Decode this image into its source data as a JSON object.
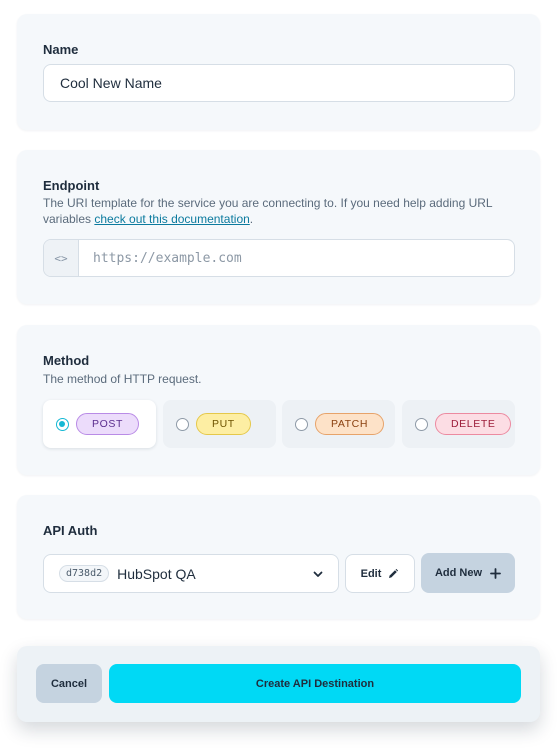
{
  "name_section": {
    "label": "Name",
    "value": "Cool New Name"
  },
  "endpoint_section": {
    "label": "Endpoint",
    "description_prefix": "The URI template for the service you are connecting to. If you need help adding URL variables ",
    "doc_link": "check out this documentation",
    "description_suffix": ".",
    "prefix_icon_glyph": "<>",
    "placeholder": "https://example.com"
  },
  "method_section": {
    "label": "Method",
    "description": "The method of HTTP request.",
    "options": [
      {
        "label": "POST",
        "selected": true
      },
      {
        "label": "PUT",
        "selected": false
      },
      {
        "label": "PATCH",
        "selected": false
      },
      {
        "label": "DELETE",
        "selected": false
      }
    ]
  },
  "auth_section": {
    "label": "API Auth",
    "selected_id": "d738d2",
    "selected_name": "HubSpot QA",
    "edit_label": "Edit",
    "add_label": "Add New"
  },
  "footer": {
    "cancel_label": "Cancel",
    "create_label": "Create API Destination"
  },
  "colors": {
    "accent": "#00d9f5",
    "post": "#ecdcfb",
    "put": "#fdeea3",
    "patch": "#fde2c8",
    "delete": "#fcdde4"
  },
  "icons": [
    "code-brackets-icon",
    "chevron-down-icon",
    "pencil-icon",
    "plus-icon"
  ]
}
